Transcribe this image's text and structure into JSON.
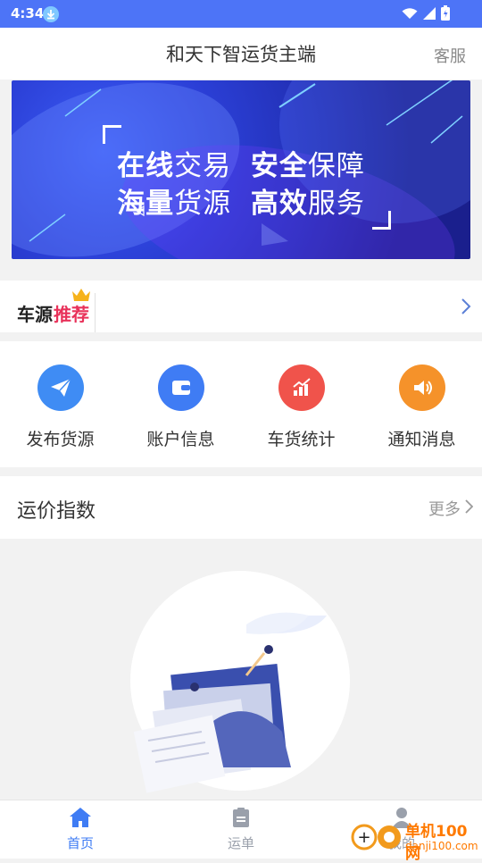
{
  "status_bar": {
    "time": "4:34"
  },
  "header": {
    "title": "和天下智运货主端",
    "service": "客服"
  },
  "banner": {
    "line1_strong1": "在线",
    "line1_normal1": "交易",
    "line1_strong2": "安全",
    "line1_normal2": "保障",
    "line2_strong1": "海量",
    "line2_normal1": "货源",
    "line2_strong2": "高效",
    "line2_normal2": "服务"
  },
  "recommend": {
    "label_black": "车源",
    "label_red": "推荐"
  },
  "quick_actions": [
    {
      "label": "发布货源",
      "icon": "paper-plane-icon",
      "color": "#3f8cf4"
    },
    {
      "label": "账户信息",
      "icon": "wallet-icon",
      "color": "#3f7cf4"
    },
    {
      "label": "车货统计",
      "icon": "stats-chart-icon",
      "color": "#f0534b"
    },
    {
      "label": "通知消息",
      "icon": "speaker-icon",
      "color": "#f5922a"
    }
  ],
  "price_index": {
    "title": "运价指数",
    "more": "更多"
  },
  "tabbar": {
    "items": [
      {
        "label": "首页",
        "icon": "home-icon",
        "active": true
      },
      {
        "label": "运单",
        "icon": "clipboard-icon",
        "active": false
      },
      {
        "label": "我的",
        "icon": "user-icon",
        "active": false
      }
    ]
  },
  "watermark": {
    "text": "单机100网",
    "url": "danji100.com"
  },
  "colors": {
    "accent": "#4d74f7",
    "hot": "#e8325a",
    "text": "#333333",
    "muted": "#9a9a9a"
  }
}
